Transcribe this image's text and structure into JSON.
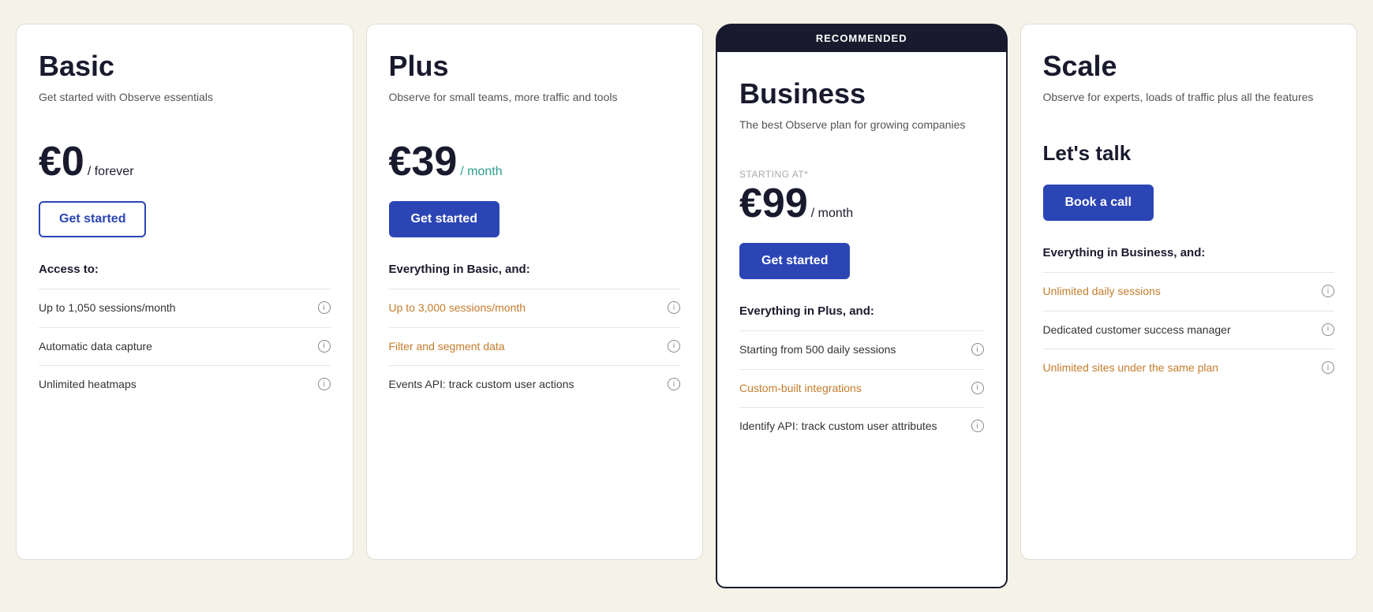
{
  "plans": [
    {
      "id": "basic",
      "title": "Basic",
      "subtitle": "Get started with Observe essentials",
      "price": "€0",
      "period": "/ forever",
      "period_color": "normal",
      "starting_at": null,
      "lets_talk": null,
      "cta_label": "Get started",
      "cta_style": "outline",
      "features_label": "Access to:",
      "features": [
        {
          "text": "Up to 1,050 sessions/month",
          "highlight": false,
          "info": true
        },
        {
          "text": "Automatic data capture",
          "highlight": false,
          "info": true
        },
        {
          "text": "Unlimited heatmaps",
          "highlight": false,
          "info": true
        }
      ],
      "recommended": false
    },
    {
      "id": "plus",
      "title": "Plus",
      "subtitle": "Observe for small teams, more traffic and tools",
      "price": "€39",
      "period": "/ month",
      "period_color": "teal",
      "starting_at": null,
      "lets_talk": null,
      "cta_label": "Get started",
      "cta_style": "primary",
      "features_label": "Everything in Basic, and:",
      "features": [
        {
          "text": "Up to 3,000 sessions/month",
          "highlight": true,
          "info": true
        },
        {
          "text": "Filter and segment data",
          "highlight": true,
          "info": true
        },
        {
          "text": "Events API: track custom user actions",
          "highlight": false,
          "info": true
        }
      ],
      "recommended": false
    },
    {
      "id": "business",
      "title": "Business",
      "subtitle": "The best Observe plan for growing companies",
      "price": "€99",
      "period": "/ month",
      "period_color": "normal",
      "starting_at": "STARTING AT*",
      "lets_talk": null,
      "cta_label": "Get started",
      "cta_style": "primary",
      "features_label": "Everything in Plus, and:",
      "features": [
        {
          "text": "Starting from 500 daily sessions",
          "highlight": false,
          "info": true
        },
        {
          "text": "Custom-built integrations",
          "highlight": true,
          "info": true
        },
        {
          "text": "Identify API: track custom user attributes",
          "highlight": false,
          "info": true
        }
      ],
      "recommended": true,
      "recommended_label": "RECOMMENDED"
    },
    {
      "id": "scale",
      "title": "Scale",
      "subtitle": "Observe for experts, loads of traffic plus all the features",
      "price": null,
      "period": null,
      "period_color": "normal",
      "starting_at": null,
      "lets_talk": "Let's talk",
      "cta_label": "Book a call",
      "cta_style": "primary",
      "features_label": "Everything in Business, and:",
      "features": [
        {
          "text": "Unlimited daily sessions",
          "highlight": true,
          "info": true
        },
        {
          "text": "Dedicated customer success manager",
          "highlight": false,
          "info": true
        },
        {
          "text": "Unlimited sites under the same plan",
          "highlight": true,
          "info": true
        }
      ],
      "recommended": false
    }
  ]
}
